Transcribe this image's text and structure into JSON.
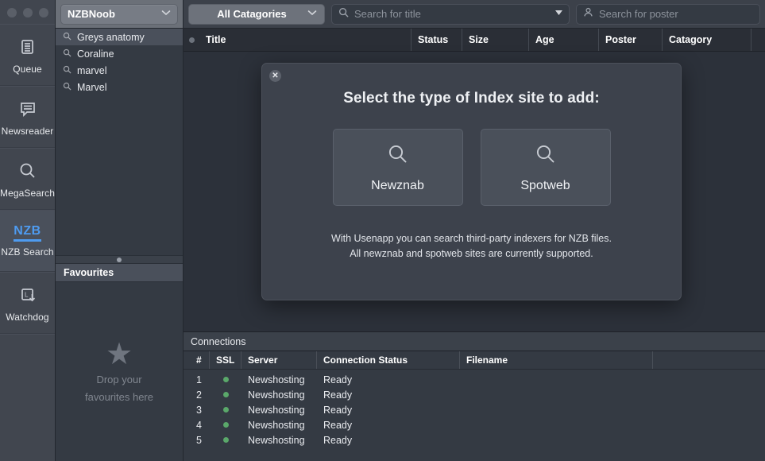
{
  "window": {
    "traffic_lights": [
      "close",
      "minimize",
      "zoom"
    ]
  },
  "rail": {
    "items": [
      {
        "label": "Queue",
        "icon": "queue-list-icon",
        "active": false
      },
      {
        "label": "Newsreader",
        "icon": "speech-bubble-icon",
        "active": false
      },
      {
        "label": "MegaSearch",
        "icon": "magnifier-icon",
        "active": false
      },
      {
        "label": "NZB Search",
        "icon": "nzb-icon",
        "badge": "NZB",
        "active": true
      },
      {
        "label": "Watchdog",
        "icon": "watchdog-download-icon",
        "active": false
      }
    ]
  },
  "left_panel": {
    "profile_combo": {
      "value": "NZBNoob",
      "icon": "chevron-down-icon"
    },
    "saved_searches": [
      {
        "label": "Greys anatomy",
        "icon": "search-icon",
        "selected": true
      },
      {
        "label": "Coraline",
        "icon": "search-icon",
        "selected": false
      },
      {
        "label": "marvel",
        "icon": "search-icon",
        "selected": false
      },
      {
        "label": "Marvel",
        "icon": "search-icon",
        "selected": false
      }
    ],
    "favourites": {
      "header": "Favourites",
      "empty_icon": "star-icon",
      "empty_line1": "Drop your",
      "empty_line2": "favourites here"
    }
  },
  "toolbar": {
    "category_combo": {
      "value": "All Catagories",
      "icon": "chevron-down-icon"
    },
    "title_search": {
      "placeholder": "Search for title",
      "value": "",
      "icon": "search-icon",
      "dropdown_icon": "triangle-down-icon"
    },
    "poster_search": {
      "placeholder": "Search for poster",
      "value": "",
      "icon": "person-icon"
    }
  },
  "results_table": {
    "columns": [
      "",
      "Title",
      "Status",
      "Size",
      "Age",
      "Poster",
      "Catagory",
      ""
    ],
    "rows": []
  },
  "connections": {
    "title": "Connections",
    "columns": [
      "#",
      "SSL",
      "Server",
      "Connection Status",
      "Filename",
      ""
    ],
    "rows": [
      {
        "num": "1",
        "ssl": "ok",
        "server": "Newshosting",
        "status": "Ready",
        "filename": ""
      },
      {
        "num": "2",
        "ssl": "ok",
        "server": "Newshosting",
        "status": "Ready",
        "filename": ""
      },
      {
        "num": "3",
        "ssl": "ok",
        "server": "Newshosting",
        "status": "Ready",
        "filename": ""
      },
      {
        "num": "4",
        "ssl": "ok",
        "server": "Newshosting",
        "status": "Ready",
        "filename": ""
      },
      {
        "num": "5",
        "ssl": "ok",
        "server": "Newshosting",
        "status": "Ready",
        "filename": ""
      }
    ]
  },
  "modal": {
    "close_icon": "close-icon",
    "title": "Select the type of Index site to add:",
    "choices": [
      {
        "label": "Newznab",
        "icon": "magnifier-icon"
      },
      {
        "label": "Spotweb",
        "icon": "magnifier-icon"
      }
    ],
    "description_line1": "With Usenapp you can search third-party indexers for NZB files.",
    "description_line2": "All newznab and spotweb sites are currently supported."
  },
  "colors": {
    "accent": "#4e9bf0",
    "status_ok": "#5aa86a",
    "window_bg": "#2c313a",
    "modal_bg": "#3d424c",
    "rail_bg": "#41464f"
  }
}
